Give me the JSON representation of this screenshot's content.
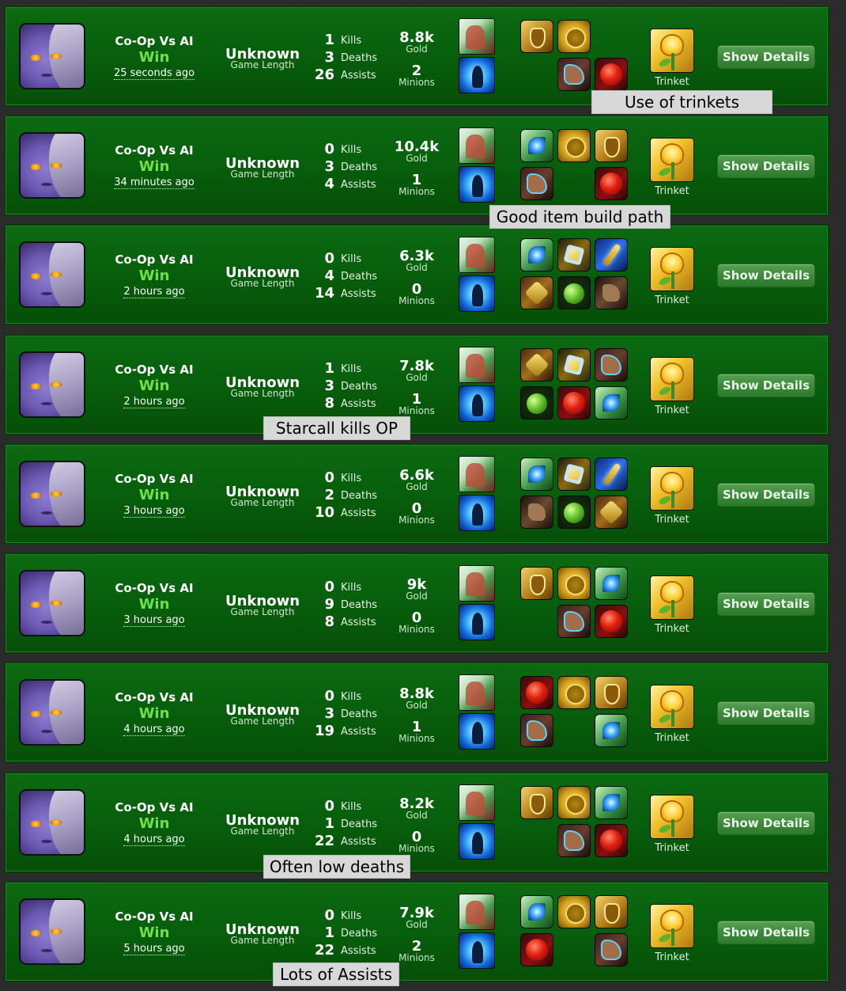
{
  "matches": [
    {
      "mode": "Co-Op Vs AI",
      "result": "Win",
      "ago": "25 seconds ago",
      "length_value": "Unknown",
      "length_label": "Game Length",
      "kills": "1",
      "kills_label": "Kills",
      "deaths": "3",
      "deaths_label": "Deaths",
      "assists": "26",
      "assists_label": "Assists",
      "gold": "8.8k",
      "gold_label": "Gold",
      "minions": "2",
      "minions_label": "Minions",
      "items": [
        "shield",
        "coin",
        "",
        "",
        "boots",
        "ruby"
      ],
      "trinket_label": "Trinket",
      "button_label": "Show Details"
    },
    {
      "mode": "Co-Op Vs AI",
      "result": "Win",
      "ago": "34 minutes ago",
      "length_value": "Unknown",
      "length_label": "Game Length",
      "kills": "0",
      "kills_label": "Kills",
      "deaths": "3",
      "deaths_label": "Deaths",
      "assists": "4",
      "assists_label": "Assists",
      "gold": "10.4k",
      "gold_label": "Gold",
      "minions": "1",
      "minions_label": "Minions",
      "items": [
        "eye",
        "coin",
        "shield",
        "boots",
        "",
        "ruby"
      ],
      "trinket_label": "Trinket",
      "button_label": "Show Details"
    },
    {
      "mode": "Co-Op Vs AI",
      "result": "Win",
      "ago": "2 hours ago",
      "length_value": "Unknown",
      "length_label": "Game Length",
      "kills": "0",
      "kills_label": "Kills",
      "deaths": "4",
      "deaths_label": "Deaths",
      "assists": "14",
      "assists_label": "Assists",
      "gold": "6.3k",
      "gold_label": "Gold",
      "minions": "0",
      "minions_label": "Minions",
      "items": [
        "eye",
        "tome",
        "wand",
        "amulet",
        "orb",
        "brownboots"
      ],
      "trinket_label": "Trinket",
      "button_label": "Show Details"
    },
    {
      "mode": "Co-Op Vs AI",
      "result": "Win",
      "ago": "2 hours ago",
      "length_value": "Unknown",
      "length_label": "Game Length",
      "kills": "1",
      "kills_label": "Kills",
      "deaths": "3",
      "deaths_label": "Deaths",
      "assists": "8",
      "assists_label": "Assists",
      "gold": "7.8k",
      "gold_label": "Gold",
      "minions": "1",
      "minions_label": "Minions",
      "items": [
        "amulet",
        "tome",
        "boots",
        "orb",
        "ruby",
        "eye"
      ],
      "trinket_label": "Trinket",
      "button_label": "Show Details"
    },
    {
      "mode": "Co-Op Vs AI",
      "result": "Win",
      "ago": "3 hours ago",
      "length_value": "Unknown",
      "length_label": "Game Length",
      "kills": "0",
      "kills_label": "Kills",
      "deaths": "2",
      "deaths_label": "Deaths",
      "assists": "10",
      "assists_label": "Assists",
      "gold": "6.6k",
      "gold_label": "Gold",
      "minions": "0",
      "minions_label": "Minions",
      "items": [
        "eye",
        "tome",
        "wand",
        "brownboots",
        "orb",
        "amulet"
      ],
      "trinket_label": "Trinket",
      "button_label": "Show Details"
    },
    {
      "mode": "Co-Op Vs AI",
      "result": "Win",
      "ago": "3 hours ago",
      "length_value": "Unknown",
      "length_label": "Game Length",
      "kills": "0",
      "kills_label": "Kills",
      "deaths": "9",
      "deaths_label": "Deaths",
      "assists": "8",
      "assists_label": "Assists",
      "gold": "9k",
      "gold_label": "Gold",
      "minions": "0",
      "minions_label": "Minions",
      "items": [
        "shield",
        "coin",
        "eye",
        "",
        "boots",
        "ruby"
      ],
      "trinket_label": "Trinket",
      "button_label": "Show Details"
    },
    {
      "mode": "Co-Op Vs AI",
      "result": "Win",
      "ago": "4 hours ago",
      "length_value": "Unknown",
      "length_label": "Game Length",
      "kills": "0",
      "kills_label": "Kills",
      "deaths": "3",
      "deaths_label": "Deaths",
      "assists": "19",
      "assists_label": "Assists",
      "gold": "8.8k",
      "gold_label": "Gold",
      "minions": "1",
      "minions_label": "Minions",
      "items": [
        "ruby",
        "coin",
        "shield",
        "boots",
        "",
        "eye"
      ],
      "trinket_label": "Trinket",
      "button_label": "Show Details"
    },
    {
      "mode": "Co-Op Vs AI",
      "result": "Win",
      "ago": "4 hours ago",
      "length_value": "Unknown",
      "length_label": "Game Length",
      "kills": "0",
      "kills_label": "Kills",
      "deaths": "1",
      "deaths_label": "Deaths",
      "assists": "22",
      "assists_label": "Assists",
      "gold": "8.2k",
      "gold_label": "Gold",
      "minions": "0",
      "minions_label": "Minions",
      "items": [
        "shield",
        "coin",
        "eye",
        "",
        "boots",
        "ruby"
      ],
      "trinket_label": "Trinket",
      "button_label": "Show Details"
    },
    {
      "mode": "Co-Op Vs AI",
      "result": "Win",
      "ago": "5 hours ago",
      "length_value": "Unknown",
      "length_label": "Game Length",
      "kills": "0",
      "kills_label": "Kills",
      "deaths": "1",
      "deaths_label": "Deaths",
      "assists": "22",
      "assists_label": "Assists",
      "gold": "7.9k",
      "gold_label": "Gold",
      "minions": "2",
      "minions_label": "Minions",
      "items": [
        "eye",
        "coin",
        "shield",
        "ruby",
        "",
        "boots"
      ],
      "trinket_label": "Trinket",
      "button_label": "Show Details"
    }
  ],
  "annotations": [
    {
      "text": "Use of trinkets"
    },
    {
      "text": "Good item build path"
    },
    {
      "text": "Starcall kills OP"
    },
    {
      "text": "Often low deaths"
    },
    {
      "text": "Lots of Assists"
    }
  ],
  "colors": {
    "row_bg": "#075d0b",
    "win": "#6fe04a",
    "button": "#3d8a3b",
    "note_bg": "#d8d8d8"
  }
}
